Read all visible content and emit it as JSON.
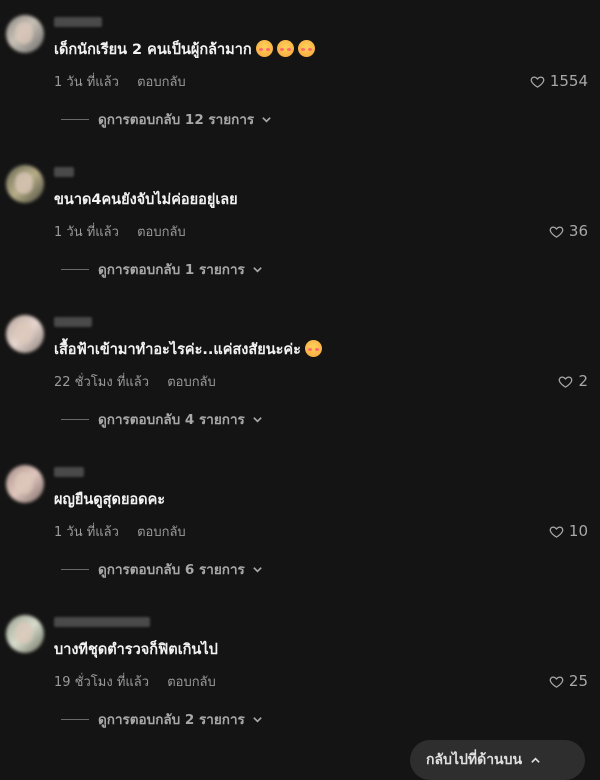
{
  "comments": [
    {
      "text": "เด็กนักเรียน 2 คนเป็นผู้กล้ามาก",
      "emoji_count": 3,
      "time": "1 วัน ที่แล้ว",
      "reply": "ตอบกลับ",
      "likes": "1554",
      "view_replies": "ดูการตอบกลับ 12 รายการ"
    },
    {
      "text": "ขนาด4คนยังจับไม่ค่อยอยู่เลย",
      "emoji_count": 0,
      "time": "1 วัน ที่แล้ว",
      "reply": "ตอบกลับ",
      "likes": "36",
      "view_replies": "ดูการตอบกลับ 1 รายการ"
    },
    {
      "text": "เสื้อฟ้าเข้ามาทำอะไรค่ะ..แค่สงสัยนะค่ะ",
      "emoji_count": 1,
      "time": "22 ชั่วโมง ที่แล้ว",
      "reply": "ตอบกลับ",
      "likes": "2",
      "view_replies": "ดูการตอบกลับ 4 รายการ"
    },
    {
      "text": "ผญยืนดูสุดยอดคะ",
      "emoji_count": 0,
      "time": "1 วัน ที่แล้ว",
      "reply": "ตอบกลับ",
      "likes": "10",
      "view_replies": "ดูการตอบกลับ 6 รายการ"
    },
    {
      "text": "บางทีชุดตำรวจก็ฟิตเกินไป",
      "emoji_count": 0,
      "time": "19 ชั่วโมง ที่แล้ว",
      "reply": "ตอบกลับ",
      "likes": "25",
      "view_replies": "ดูการตอบกลับ 2 รายการ"
    }
  ],
  "bottom_pill": {
    "label": "กลับไปที่ด้านบน"
  },
  "icons": {
    "like": "heart-icon",
    "expand": "chevron-down-icon"
  }
}
